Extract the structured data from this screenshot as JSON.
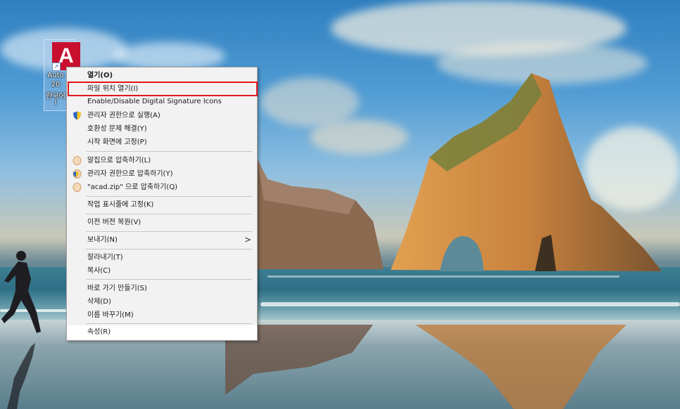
{
  "desktop": {
    "icon": {
      "logo_letter": "A",
      "label_lines": [
        "Auto",
        "20",
        "한국어",
        "I"
      ]
    }
  },
  "context_menu": {
    "items": [
      {
        "label": "열기(O)",
        "bold": true
      },
      {
        "label": "파일 위치 열기(I)",
        "highlighted": true
      },
      {
        "label": "Enable/Disable Digital Signature Icons"
      },
      {
        "label": "관리자 권한으로 실행(A)",
        "icon": "uac-shield-icon"
      },
      {
        "label": "호환성 문제 해결(Y)"
      },
      {
        "label": "시작 화면에 고정(P)"
      },
      {
        "label": "알집으로 압축하기(L)",
        "icon": "alzip-icon"
      },
      {
        "label": "관리자 권한으로 압축하기(Y)",
        "icon": "uac-shield-alzip-icon"
      },
      {
        "label": "\"acad.zip\" 으로 압축하기(Q)",
        "icon": "alzip-icon"
      },
      {
        "label": "작업 표시줄에 고정(K)"
      },
      {
        "label": "이전 버전 복원(V)"
      },
      {
        "label": "보내기(N)",
        "submenu": true,
        "chevron": ">"
      },
      {
        "label": "잘라내기(T)"
      },
      {
        "label": "복사(C)"
      },
      {
        "label": "바로 가기 만들기(S)"
      },
      {
        "label": "삭제(D)"
      },
      {
        "label": "이름 바꾸기(M)"
      },
      {
        "label": "속성(R)"
      }
    ]
  },
  "colors": {
    "highlight_border": "#e5151b",
    "autocad_red": "#c8102e",
    "menu_bg": "#f2f2f2"
  }
}
